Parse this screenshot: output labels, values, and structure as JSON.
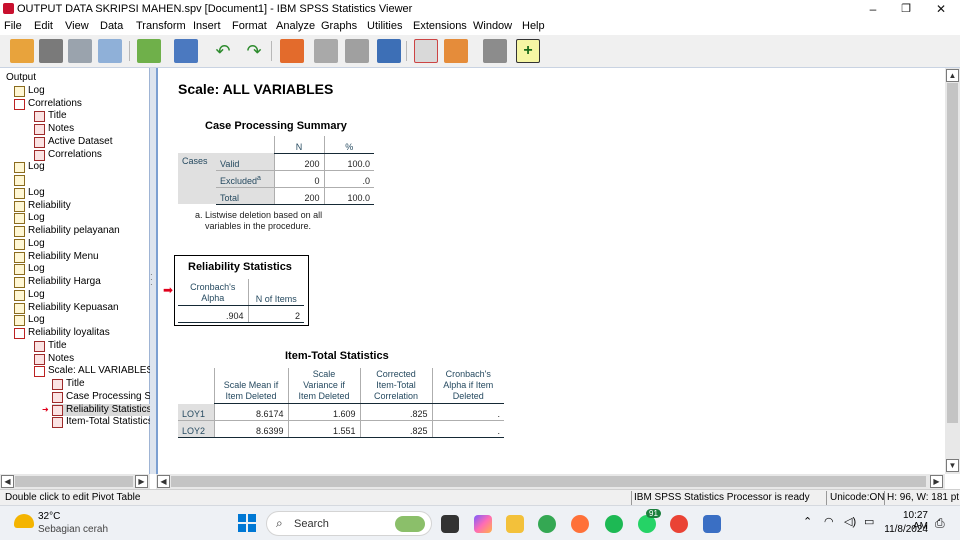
{
  "window": {
    "title": "OUTPUT DATA SKRIPSI MAHEN.spv [Document1] - IBM SPSS Statistics Viewer"
  },
  "window_controls": {
    "minimize": "–",
    "restore": "❐",
    "close": "✕"
  },
  "menubar": [
    "File",
    "Edit",
    "View",
    "Data",
    "Transform",
    "Insert",
    "Format",
    "Analyze",
    "Graphs",
    "Utilities",
    "Extensions",
    "Window",
    "Help"
  ],
  "toolbar": {
    "icons": [
      "open-folder-icon",
      "save-icon",
      "print-icon",
      "print-preview-icon",
      "export-icon",
      "recall-dialog-icon",
      "undo-icon",
      "redo-icon",
      "goto-data-icon",
      "goto-case-icon",
      "goto-variable-icon",
      "variables-icon",
      "show-all-icon",
      "designate-window-icon",
      "insert-output-icon",
      "create-syntax-icon"
    ]
  },
  "nav_tree": [
    {
      "label": "Output",
      "level": 0,
      "icon": "none"
    },
    {
      "label": "Log",
      "level": 1,
      "icon": "book"
    },
    {
      "label": "Correlations",
      "level": 1,
      "icon": "red"
    },
    {
      "label": "Title",
      "level": 2,
      "icon": "pivot"
    },
    {
      "label": "Notes",
      "level": 2,
      "icon": "pivot"
    },
    {
      "label": "Active Dataset",
      "level": 2,
      "icon": "pivot"
    },
    {
      "label": "Correlations",
      "level": 2,
      "icon": "pivot"
    },
    {
      "label": "Log",
      "level": 1,
      "icon": "book"
    },
    {
      "label": "",
      "level": 1,
      "icon": "book"
    },
    {
      "label": "Log",
      "level": 1,
      "icon": "book"
    },
    {
      "label": "Reliability",
      "level": 1,
      "icon": "book"
    },
    {
      "label": "Log",
      "level": 1,
      "icon": "book"
    },
    {
      "label": "Reliability pelayanan",
      "level": 1,
      "icon": "book"
    },
    {
      "label": "Log",
      "level": 1,
      "icon": "book"
    },
    {
      "label": "Reliability Menu",
      "level": 1,
      "icon": "book"
    },
    {
      "label": "Log",
      "level": 1,
      "icon": "book"
    },
    {
      "label": "Reliability Harga",
      "level": 1,
      "icon": "book"
    },
    {
      "label": "Log",
      "level": 1,
      "icon": "book"
    },
    {
      "label": "Reliability Kepuasan",
      "level": 1,
      "icon": "book"
    },
    {
      "label": "Log",
      "level": 1,
      "icon": "book"
    },
    {
      "label": "Reliability loyalitas",
      "level": 1,
      "icon": "red"
    },
    {
      "label": "Title",
      "level": 2,
      "icon": "pivot"
    },
    {
      "label": "Notes",
      "level": 2,
      "icon": "pivot"
    },
    {
      "label": "Scale: ALL VARIABLES",
      "level": 2,
      "icon": "red"
    },
    {
      "label": "Title",
      "level": 3,
      "icon": "pivot"
    },
    {
      "label": "Case Processing Su",
      "level": 3,
      "icon": "pivot"
    },
    {
      "label": "Reliability Statistics",
      "level": 3,
      "icon": "pivot",
      "selected": true
    },
    {
      "label": "Item-Total Statistics",
      "level": 3,
      "icon": "pivot"
    }
  ],
  "content": {
    "scale_title": "Scale: ALL VARIABLES",
    "case_processing": {
      "title": "Case Processing Summary",
      "col_n": "N",
      "col_pct": "%",
      "group": "Cases",
      "rows": [
        {
          "label": "Valid",
          "n": "200",
          "pct": "100.0"
        },
        {
          "label": "Excluded",
          "sup": "a",
          "n": "0",
          "pct": ".0"
        },
        {
          "label": "Total",
          "n": "200",
          "pct": "100.0"
        }
      ],
      "footnote_line1": "a. Listwise deletion based on all",
      "footnote_line2": "variables in the procedure."
    },
    "reliability": {
      "title": "Reliability Statistics",
      "col_alpha_1": "Cronbach's",
      "col_alpha_2": "Alpha",
      "col_items": "N of Items",
      "alpha": ".904",
      "n_items": "2"
    },
    "item_total": {
      "title": "Item-Total Statistics",
      "headers": [
        [
          "Scale Mean if",
          "Item Deleted"
        ],
        [
          "Scale",
          "Variance if",
          "Item Deleted"
        ],
        [
          "Corrected",
          "Item-Total",
          "Correlation"
        ],
        [
          "Cronbach's",
          "Alpha if Item",
          "Deleted"
        ]
      ],
      "rows": [
        {
          "label": "LOY1",
          "mean": "8.6174",
          "var": "1.609",
          "corr": ".825",
          "alpha": "."
        },
        {
          "label": "LOY2",
          "mean": "8.6399",
          "var": "1.551",
          "corr": ".825",
          "alpha": "."
        }
      ]
    }
  },
  "statusbar": {
    "left": "Double click to edit Pivot Table",
    "processor": "IBM SPSS Statistics Processor is ready",
    "unicode": "Unicode:ON",
    "size": "H: 96, W: 181 pt."
  },
  "taskbar": {
    "weather_temp": "32°C",
    "weather_desc": "Sebagian cerah",
    "search_placeholder": "Search",
    "badge_count": "91",
    "time": "10:27 AM",
    "date": "11/8/2024"
  }
}
